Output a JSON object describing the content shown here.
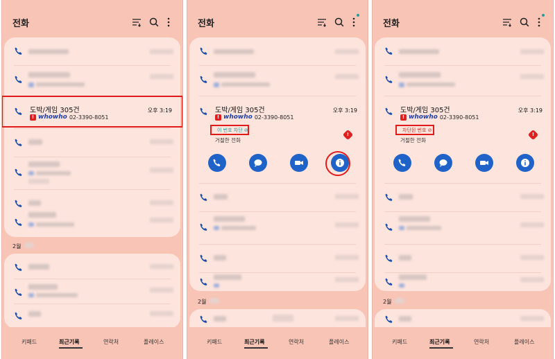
{
  "app_title": "전화",
  "caller": {
    "name": "도박/게임 305건",
    "brand": "whowho",
    "number": "02-3390-8051",
    "time": "오후 3:19",
    "warn_glyph": "!"
  },
  "screen2": {
    "chip_label": "이 번호 차단 ⊘",
    "declined_label": "거절한 전화"
  },
  "screen3": {
    "chip_label": "차단된 번호 ⊘",
    "declined_label": "거절한 전화"
  },
  "section_month": "2월",
  "bottom_nav": [
    "키패드",
    "최근기록",
    "연락처",
    "플레이스"
  ],
  "colors": {
    "background": "#f8c4b6",
    "card": "#fde4dd",
    "highlight": "#e11a1a",
    "action_button": "#1f63c9",
    "brand": "#1e3fa8"
  },
  "icons": [
    "filter-icon",
    "search-icon",
    "more-icon",
    "call-icon",
    "message-icon",
    "video-call-icon",
    "info-icon"
  ]
}
